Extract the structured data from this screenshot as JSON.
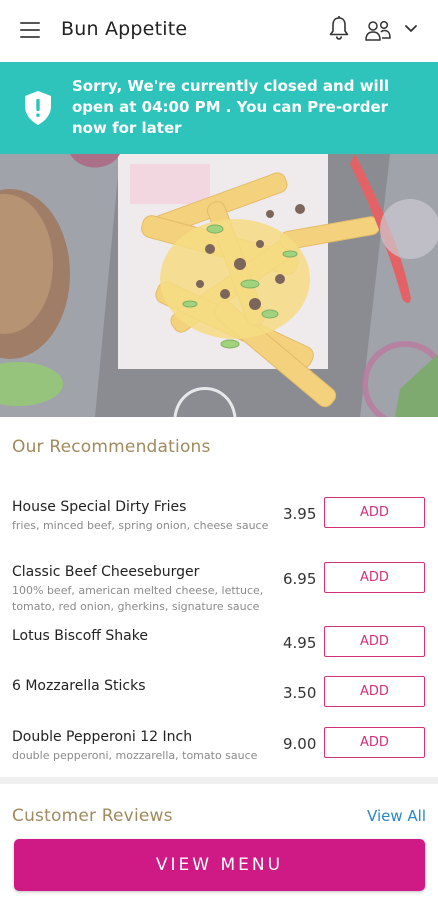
{
  "header": {
    "title": "Bun Appetite",
    "icons": [
      "menu-icon",
      "bell-icon",
      "user-icon",
      "chevron-down-icon"
    ]
  },
  "banner": {
    "icon": "shield-alert-icon",
    "message": "Sorry, We're currently closed and will open at 04:00 PM . You can Pre-order now for later",
    "color": "#2ec4bb"
  },
  "recommendations": {
    "title": "Our Recommendations",
    "add_label": "ADD",
    "items": [
      {
        "name": "House Special Dirty Fries",
        "desc": "fries, minced beef, spring onion, cheese sauce",
        "price": "3.95"
      },
      {
        "name": "Classic Beef Cheeseburger",
        "desc": "100% beef, american melted cheese, lettuce, tomato, red onion, gherkins, signature sauce",
        "price": "6.95"
      },
      {
        "name": "Lotus Biscoff Shake",
        "desc": "",
        "price": "4.95"
      },
      {
        "name": "6 Mozzarella Sticks",
        "desc": "",
        "price": "3.50"
      },
      {
        "name": "Double Pepperoni 12 Inch",
        "desc": "double pepperoni, mozzarella, tomato sauce",
        "price": "9.00"
      }
    ]
  },
  "reviews": {
    "title": "Customer Reviews",
    "view_all": "View All"
  },
  "cta": {
    "label": "VIEW MENU",
    "color": "#cf1a86"
  },
  "colors": {
    "accent": "#d3307a",
    "section_title": "#a08a5e",
    "link": "#2a87c8"
  }
}
